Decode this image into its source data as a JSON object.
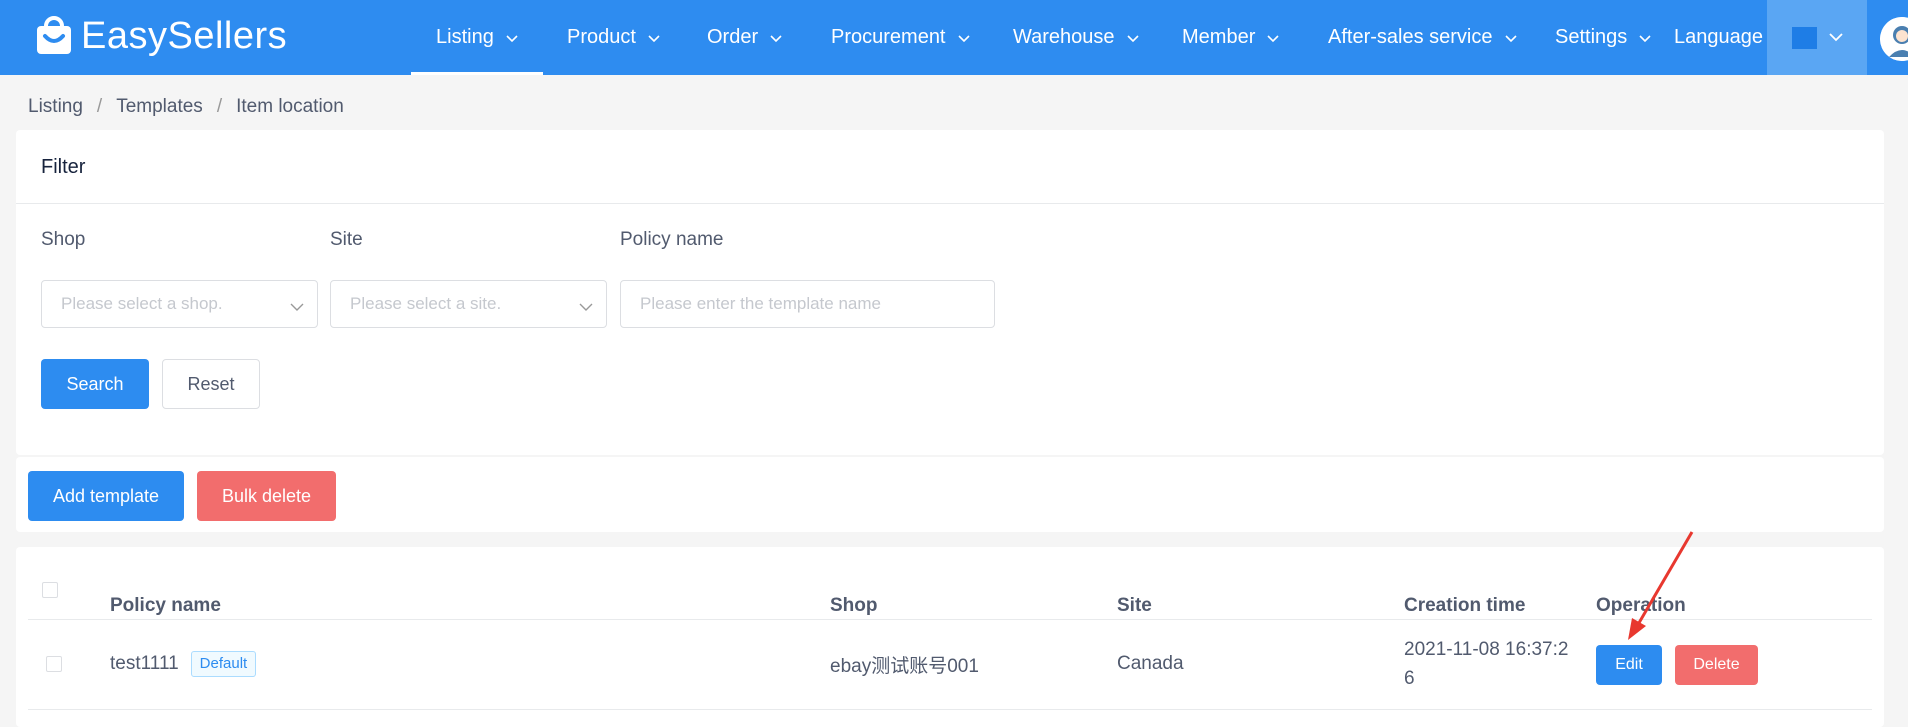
{
  "app": {
    "logo_text": "EasySellers"
  },
  "nav": {
    "items": [
      {
        "label": "Listing",
        "active": true
      },
      {
        "label": "Product"
      },
      {
        "label": "Order"
      },
      {
        "label": "Procurement"
      },
      {
        "label": "Warehouse"
      },
      {
        "label": "Member"
      },
      {
        "label": "After-sales service"
      },
      {
        "label": "Settings"
      }
    ],
    "language_label": "Language"
  },
  "breadcrumb": [
    "Listing",
    "Templates",
    "Item location"
  ],
  "filter": {
    "title": "Filter",
    "shop": {
      "label": "Shop",
      "placeholder": "Please select a shop."
    },
    "site": {
      "label": "Site",
      "placeholder": "Please select a site."
    },
    "policy_name": {
      "label": "Policy name",
      "placeholder": "Please enter the template name"
    },
    "search_label": "Search",
    "reset_label": "Reset"
  },
  "actions": {
    "add_label": "Add template",
    "bulk_delete_label": "Bulk delete"
  },
  "table": {
    "columns": [
      "Policy name",
      "Shop",
      "Site",
      "Creation time",
      "Operation"
    ],
    "rows": [
      {
        "policy_name": "test1111",
        "tag": "Default",
        "shop": "ebay测试账号001",
        "site": "Canada",
        "creation_time_line1": "2021-11-08 16:37:2",
        "creation_time_line2": "6",
        "edit_label": "Edit",
        "delete_label": "Delete"
      }
    ]
  },
  "colors": {
    "primary": "#2d8cf0",
    "danger": "#f26d6d",
    "topbar": "#2e8cf0",
    "annotation_arrow": "#e8382f"
  }
}
